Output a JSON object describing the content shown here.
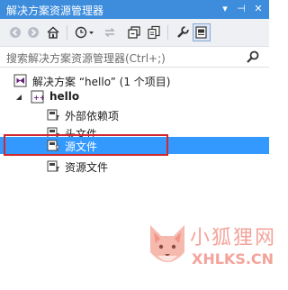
{
  "window": {
    "title": "解决方案资源管理器",
    "pin_glyph": "▾",
    "pin2_glyph": "⊣",
    "close_glyph": "✕"
  },
  "toolbar": {
    "buttons": [
      "back-icon",
      "forward-icon",
      "home-icon",
      "history-icon",
      "sync-icon",
      "collapse-icon",
      "show-all-icon",
      "properties-icon",
      "preview-icon"
    ]
  },
  "search": {
    "placeholder": "搜索解决方案资源管理器(Ctrl+;)"
  },
  "tree": {
    "solution": "解决方案 “hello” (1 个项目)",
    "project": "hello",
    "items": [
      {
        "label": "外部依赖项"
      },
      {
        "label": "头文件"
      },
      {
        "label": "源文件"
      },
      {
        "label": "资源文件"
      }
    ],
    "selected_index": 2
  },
  "watermark": {
    "name": "小狐狸网",
    "domain": "XHLKS.CN"
  },
  "colors": {
    "titlebar": "#3e8ddd",
    "selection": "#3399ff",
    "highlight_box": "#d0282e"
  }
}
